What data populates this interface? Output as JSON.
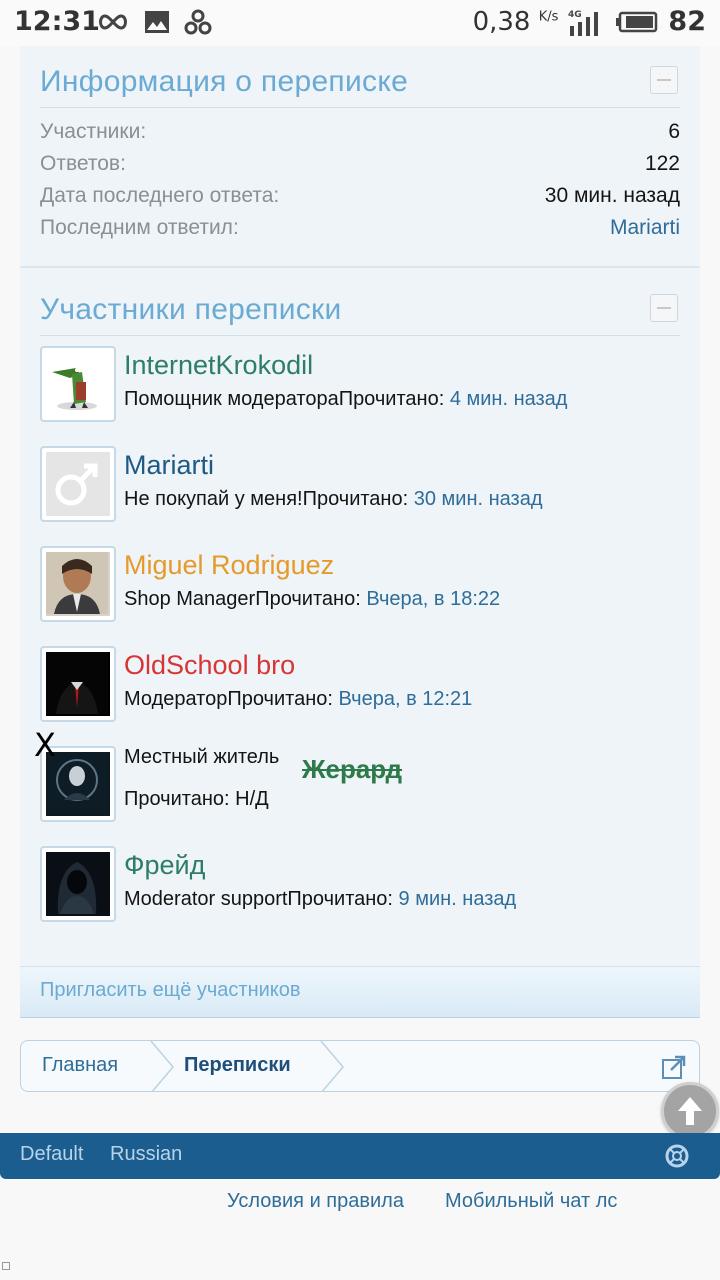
{
  "status_bar": {
    "time": "12:31",
    "speed": "0,38",
    "speed_unit": "K/s",
    "network": "4G",
    "battery": "82"
  },
  "info_section": {
    "title": "Информация о переписке",
    "rows": [
      {
        "label": "Участники:",
        "value": "6"
      },
      {
        "label": "Ответов:",
        "value": "122"
      },
      {
        "label": "Дата последнего ответа:",
        "value": "30 мин. назад"
      },
      {
        "label": "Последним ответил:",
        "value": "Mariarti"
      }
    ]
  },
  "members_section": {
    "title": "Участники переписки",
    "members": [
      {
        "name": "InternetKrokodil",
        "name_color": "#2e7d6b",
        "title": "Помощник модератора",
        "read_label": "Прочитано: ",
        "read_time": "4 мин. назад"
      },
      {
        "name": "Mariarti",
        "name_color": "#1d5a85",
        "title": "Не покупай у меня!",
        "read_label": "Прочитано: ",
        "read_time": "30 мин. назад"
      },
      {
        "name": "Miguel Rodriguez",
        "name_color": "#e59a2a",
        "title": "Shop Manager",
        "read_label": "Прочитано: ",
        "read_time": "Вчера, в 18:22"
      },
      {
        "name": "OldSchool bro",
        "name_color": "#d83535",
        "title": "Модератор",
        "read_label": "Прочитано: ",
        "read_time": "Вчера, в 12:21"
      },
      {
        "name": "Жерард",
        "name_color": "#2e7a4a",
        "title": "Местный житель",
        "read_label": "Прочитано: ",
        "read_time": "Н/Д"
      },
      {
        "name": "Фрейд",
        "name_color": "#2e7d6b",
        "title": "Moderator support",
        "read_label": "Прочитано: ",
        "read_time": "9 мин. назад"
      }
    ],
    "x_mark": "X",
    "invite_label": "Пригласить ещё участников"
  },
  "breadcrumb": {
    "home": "Главная",
    "current": "Переписки"
  },
  "footer": {
    "style": "Default",
    "language": "Russian",
    "terms": "Условия и правила",
    "mobile_chat": "Мобильный чат лс"
  }
}
